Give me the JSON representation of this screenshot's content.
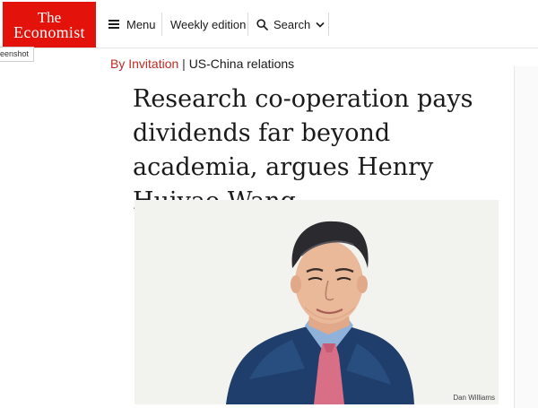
{
  "header": {
    "logo_line1": "The",
    "logo_line2": "Economist",
    "menu_label": "Menu",
    "weekly_label": "Weekly edition",
    "search_label": "Search"
  },
  "tooltip": {
    "text": "eenshot"
  },
  "article": {
    "section": "By Invitation",
    "separator": "|",
    "topic": "US-China relations",
    "headline": "Research co-operation pays dividends far beyond academia, argues Henry Huiyao Wang",
    "image_credit": "Dan Williams"
  },
  "colors": {
    "brand_red": "#e3120b",
    "section_red": "#c12a21",
    "suit": "#1f3e6b",
    "tie": "#d86f86"
  },
  "icons": [
    "hamburger-menu-icon",
    "search-icon",
    "chevron-down-icon"
  ]
}
